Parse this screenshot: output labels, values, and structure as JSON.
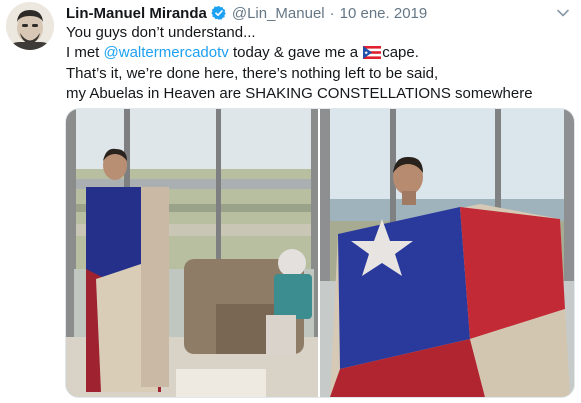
{
  "tweet": {
    "author_name": "Lin-Manuel Miranda",
    "handle": "@Lin_Manuel",
    "separator": "·",
    "date": "10 ene. 2019",
    "verified": true,
    "line1": "You guys don’t understand...",
    "line2_before": "I met ",
    "line2_mention": "@waltermercadotv",
    "line2_after": " today & gave me a ",
    "line2_end": "cape.",
    "line3": "That’s it, we’re done here, there’s nothing left to be said,",
    "line4": "my Abuelas in Heaven are SHAKING CONSTELLATIONS somewhere",
    "flag_icon": "puerto-rico-flag-emoji",
    "colors": {
      "text": "#14171a",
      "secondary": "#657786",
      "link": "#1da1f2",
      "verified": "#1da1f2"
    }
  }
}
